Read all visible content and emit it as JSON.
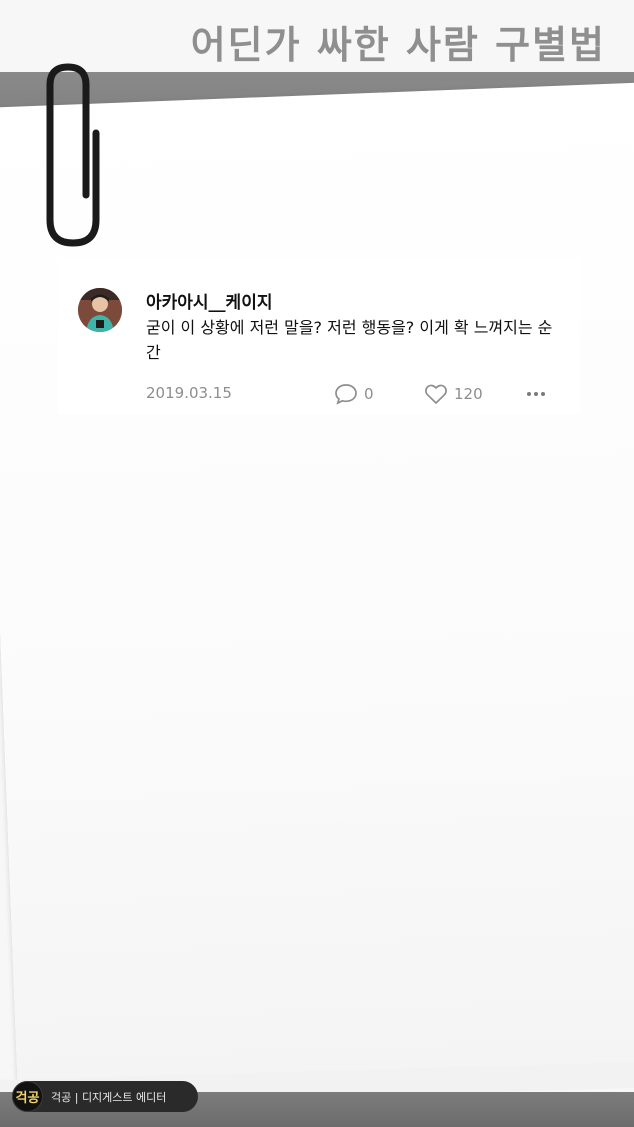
{
  "headline": "어딘가 싸한 사람 구별법",
  "post": {
    "username": "아카아시__케이지",
    "text": "굳이 이 상황에 저런 말을? 저런 행동을? 이게 확 느껴지는 순간",
    "date": "2019.03.15",
    "comment_count": "0",
    "like_count": "120"
  },
  "watermark": {
    "logo": "걱공",
    "text": "걱공 | 디지게스트 에디터"
  },
  "icons": {
    "comment": "speech-bubble-icon",
    "like": "heart-icon",
    "more": "more-dots-icon",
    "paperclip": "paperclip-icon"
  },
  "colors": {
    "band": "#7a7a7a",
    "meta_gray": "#8e8e8e",
    "text": "#111111"
  }
}
